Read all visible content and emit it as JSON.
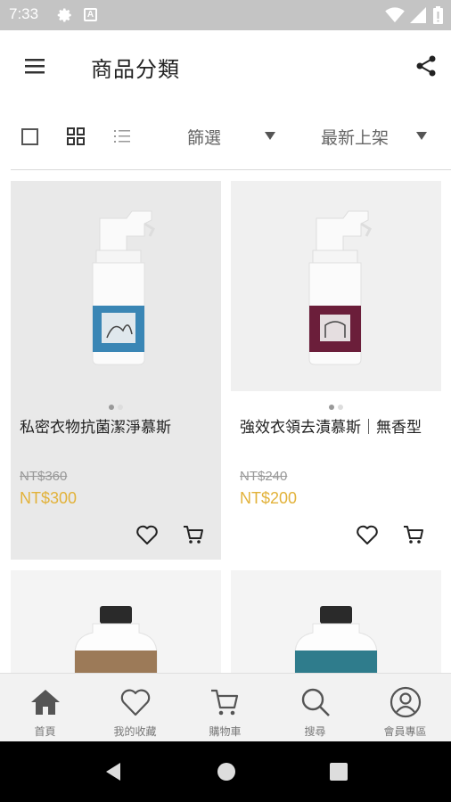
{
  "status_bar": {
    "time": "7:33"
  },
  "app_bar": {
    "title": "商品分類"
  },
  "toolbar": {
    "filter_label": "篩選",
    "sort_label": "最新上架"
  },
  "products": [
    {
      "name": "私密衣物抗菌潔淨慕斯",
      "old_price": "NT$360",
      "price": "NT$300",
      "label_color": "#3a86b5"
    },
    {
      "name": "強效衣領去漬慕斯｜無香型",
      "old_price": "NT$240",
      "price": "NT$200",
      "label_color": "#6b1e3a"
    },
    {
      "name": "",
      "old_price": "",
      "price": "",
      "label_color": "#9c7a58"
    },
    {
      "name": "",
      "old_price": "",
      "price": "",
      "label_color": "#2f7c8c"
    }
  ],
  "bottom_nav": [
    {
      "label": "首頁",
      "icon": "home-icon"
    },
    {
      "label": "我的收藏",
      "icon": "heart-icon"
    },
    {
      "label": "購物車",
      "icon": "cart-icon"
    },
    {
      "label": "搜尋",
      "icon": "search-icon"
    },
    {
      "label": "會員專區",
      "icon": "user-icon"
    }
  ],
  "colors": {
    "price": "#e2b23a",
    "status_bar": "#c4c4c4",
    "nav_bg": "#f2f2f2"
  }
}
